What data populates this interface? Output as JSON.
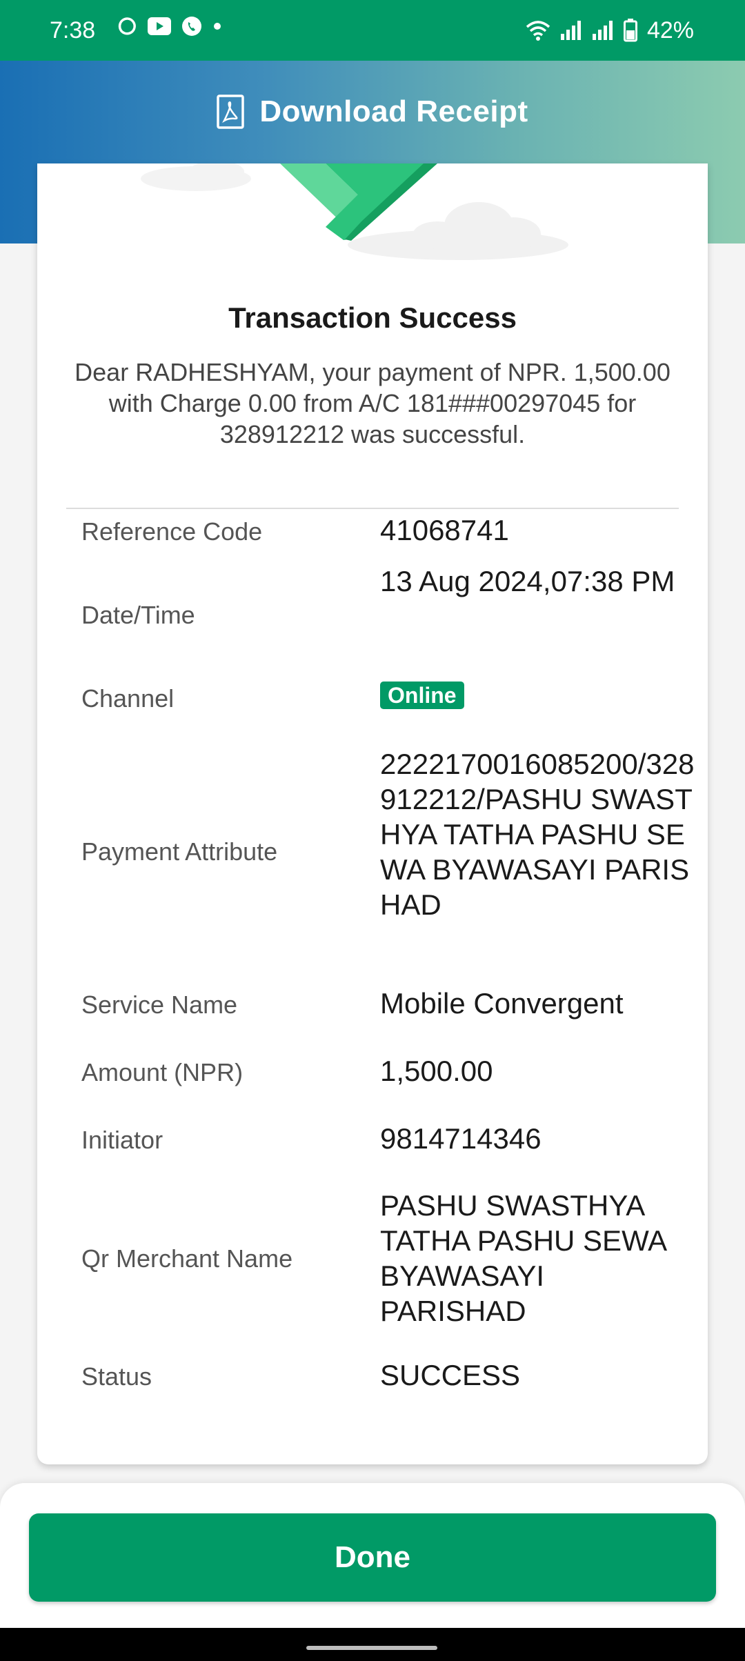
{
  "status_bar": {
    "time": "7:38",
    "battery": "42%",
    "left_icons": [
      "sync-icon",
      "youtube-icon",
      "viber-icon",
      "dot-icon"
    ],
    "right_icons": [
      "wifi-icon",
      "signal-icon",
      "signal-icon",
      "battery-icon"
    ]
  },
  "header": {
    "download_label": "Download Receipt",
    "icon": "pdf-file-icon"
  },
  "receipt": {
    "title": "Transaction Success",
    "message": "Dear RADHESHYAM, your payment of NPR. 1,500.00 with Charge 0.00 from A/C 181###00297045 for 328912212 was successful.",
    "rows": [
      {
        "label": "Reference Code",
        "value": "41068741"
      },
      {
        "label": "Date/Time",
        "value": "13 Aug 2024,07:38 PM"
      },
      {
        "label": "Channel",
        "value": "Online"
      },
      {
        "label": "Payment Attribute",
        "value": "2222170016085200/328912212/PASHU SWASTHYA TATHA PASHU SEWA BYAWASAYI PARISHAD"
      },
      {
        "label": "Service Name",
        "value": "Mobile Convergent"
      },
      {
        "label": "Amount (NPR)",
        "value": "1,500.00"
      },
      {
        "label": "Initiator",
        "value": "9814714346"
      },
      {
        "label": "Qr Merchant Name",
        "value": "PASHU SWASTHYA TATHA PASHU SEWA BYAWASAYI PARISHAD"
      },
      {
        "label": "Status",
        "value": "SUCCESS"
      }
    ]
  },
  "footer": {
    "done_label": "Done"
  },
  "colors": {
    "brand_green": "#019a66",
    "header_blue": "#1a6fb4",
    "header_teal": "#8ccbb0"
  }
}
